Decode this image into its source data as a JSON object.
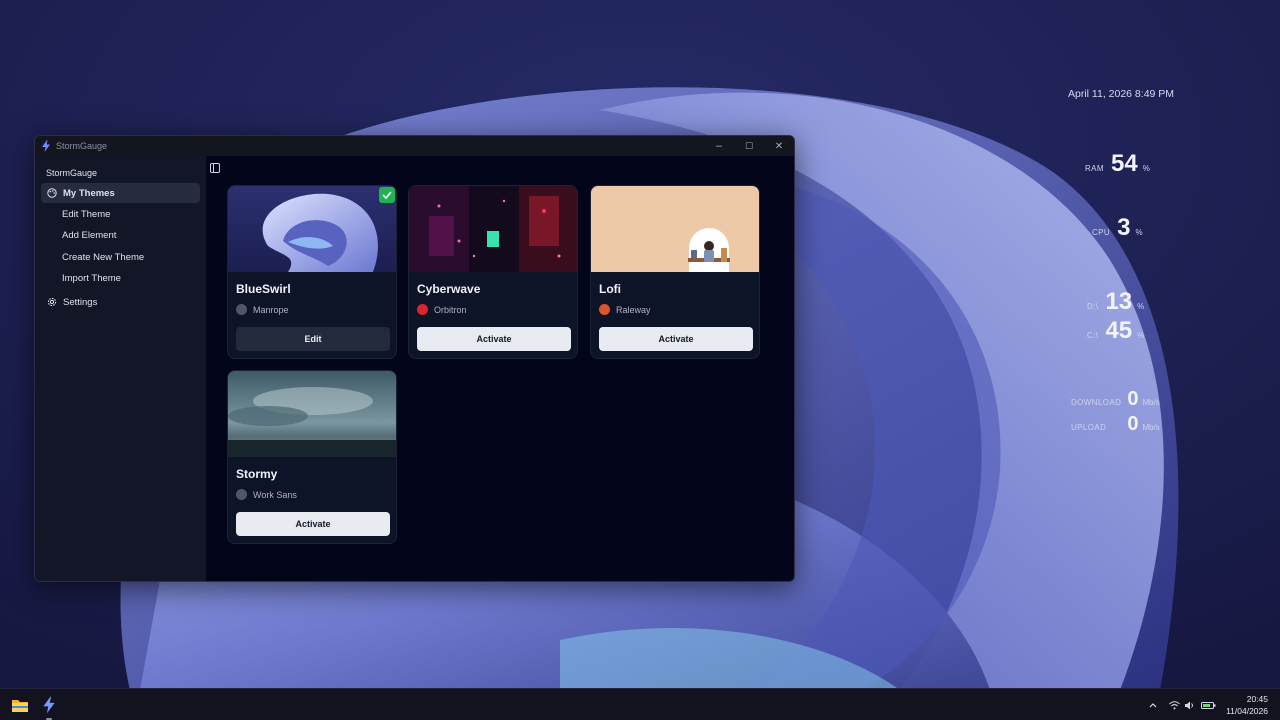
{
  "window": {
    "title": "StormGauge",
    "controls": {
      "minimize": "–",
      "maximize": "☐",
      "close": "✕"
    }
  },
  "sidebar": {
    "title": "StormGauge",
    "items": [
      {
        "label": "My Themes",
        "icon": "palette-icon",
        "active": true
      },
      {
        "label": "Edit Theme"
      },
      {
        "label": "Add Element"
      },
      {
        "label": "Create New Theme"
      },
      {
        "label": "Import Theme"
      },
      {
        "label": "Settings",
        "icon": "gear-icon"
      }
    ]
  },
  "themes": [
    {
      "name": "BlueSwirl",
      "font": "Manrope",
      "font_color": "#50556a",
      "button": "Edit",
      "active": true
    },
    {
      "name": "Cyberwave",
      "font": "Orbitron",
      "font_color": "#d9262e",
      "button": "Activate",
      "active": false
    },
    {
      "name": "Lofi",
      "font": "Raleway",
      "font_color": "#d9552b",
      "button": "Activate",
      "active": false
    },
    {
      "name": "Stormy",
      "font": "Work Sans",
      "font_color": "#50556a",
      "button": "Activate",
      "active": false
    }
  ],
  "widget": {
    "date": "April 11, 2026 8:49 PM",
    "ram": {
      "label": "RAM",
      "value": "54",
      "unit": "%"
    },
    "cpu": {
      "label": "CPU",
      "value": "3",
      "unit": "%"
    },
    "disk_d": {
      "label": "D:\\",
      "value": "13",
      "unit": "%"
    },
    "disk_c": {
      "label": "C:\\",
      "value": "45",
      "unit": "%"
    },
    "download": {
      "label": "DOWNLOAD",
      "value": "0",
      "unit": "Mb/s"
    },
    "upload": {
      "label": "UPLOAD",
      "value": "0",
      "unit": "Mb/s"
    }
  },
  "taskbar": {
    "apps": [
      "file-explorer-icon",
      "stormgauge-icon"
    ],
    "tray": {
      "chevron": "^"
    },
    "clock": {
      "time": "20:45",
      "date": "11/04/2026"
    }
  },
  "colors": {
    "accent_check": "#21b351",
    "window_bg": "#03061a",
    "sidebar_bg": "#121626",
    "card_bg": "#0e1428"
  }
}
